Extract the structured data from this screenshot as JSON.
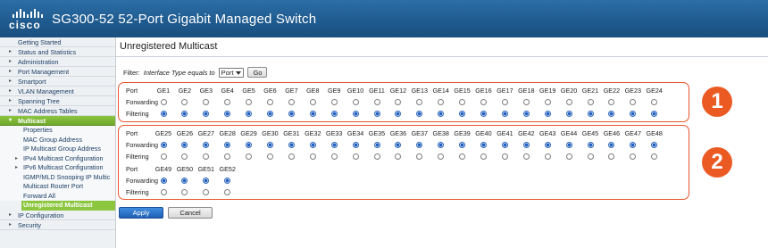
{
  "header": {
    "logo_text": "cisco",
    "title": "SG300-52 52-Port Gigabit Managed Switch"
  },
  "sidebar": {
    "items": [
      {
        "label": "Getting Started",
        "kind": "top",
        "arrow": ""
      },
      {
        "label": "Status and Statistics",
        "kind": "top",
        "arrow": "▸"
      },
      {
        "label": "Administration",
        "kind": "top",
        "arrow": "▸"
      },
      {
        "label": "Port Management",
        "kind": "top",
        "arrow": "▸"
      },
      {
        "label": "Smartport",
        "kind": "top",
        "arrow": "▸"
      },
      {
        "label": "VLAN Management",
        "kind": "top",
        "arrow": "▸"
      },
      {
        "label": "Spanning Tree",
        "kind": "top",
        "arrow": "▸"
      },
      {
        "label": "MAC Address Tables",
        "kind": "top",
        "arrow": "▸"
      },
      {
        "label": "Multicast",
        "kind": "active-top",
        "arrow": "▾"
      },
      {
        "label": "Properties",
        "kind": "sub",
        "arrow": ""
      },
      {
        "label": "MAC Group Address",
        "kind": "sub",
        "arrow": ""
      },
      {
        "label": "IP Multicast Group Address",
        "kind": "sub",
        "arrow": ""
      },
      {
        "label": "IPv4 Multicast Configuration",
        "kind": "sub",
        "arrow": "▸"
      },
      {
        "label": "IPv6 Multicast Configuration",
        "kind": "sub",
        "arrow": "▸"
      },
      {
        "label": "IGMP/MLD Snooping IP Multic",
        "kind": "sub",
        "arrow": ""
      },
      {
        "label": "Multicast Router Port",
        "kind": "sub",
        "arrow": ""
      },
      {
        "label": "Forward All",
        "kind": "sub",
        "arrow": ""
      },
      {
        "label": "Unregistered Multicast",
        "kind": "sub current",
        "arrow": ""
      },
      {
        "label": "IP Configuration",
        "kind": "top",
        "arrow": "▸"
      },
      {
        "label": "Security",
        "kind": "top",
        "arrow": "▸"
      }
    ]
  },
  "main": {
    "title": "Unregistered Multicast",
    "filter": {
      "label": "Filter:",
      "condition": "Interface Type equals to",
      "value": "Port",
      "go_label": "Go"
    },
    "row_labels": {
      "port": "Port",
      "forwarding": "Forwarding",
      "filtering": "Filtering"
    },
    "groups": [
      {
        "ports": [
          "GE1",
          "GE2",
          "GE3",
          "GE4",
          "GE5",
          "GE6",
          "GE7",
          "GE8",
          "GE9",
          "GE10",
          "GE11",
          "GE12",
          "GE13",
          "GE14",
          "GE15",
          "GE16",
          "GE17",
          "GE18",
          "GE19",
          "GE20",
          "GE21",
          "GE22",
          "GE23",
          "GE24"
        ],
        "selected": "filtering"
      },
      {
        "ports": [
          "GE25",
          "GE26",
          "GE27",
          "GE28",
          "GE29",
          "GE30",
          "GE31",
          "GE32",
          "GE33",
          "GE34",
          "GE35",
          "GE36",
          "GE37",
          "GE38",
          "GE39",
          "GE40",
          "GE41",
          "GE42",
          "GE43",
          "GE44",
          "GE45",
          "GE46",
          "GE47",
          "GE48"
        ],
        "selected": "forwarding"
      },
      {
        "ports": [
          "GE49",
          "GE50",
          "GE51",
          "GE52"
        ],
        "selected": "forwarding"
      }
    ],
    "badges": [
      "1",
      "2"
    ],
    "apply_label": "Apply",
    "cancel_label": "Cancel"
  },
  "colors": {
    "header": "#1f5a8e",
    "active": "#8cc63f",
    "highlight_box": "#e8552d",
    "badge": "#ec5a24",
    "apply": "#1f5fb4"
  },
  "icons": {
    "dropdown": "chevron-down-icon",
    "expand": "triangle-right-icon"
  }
}
